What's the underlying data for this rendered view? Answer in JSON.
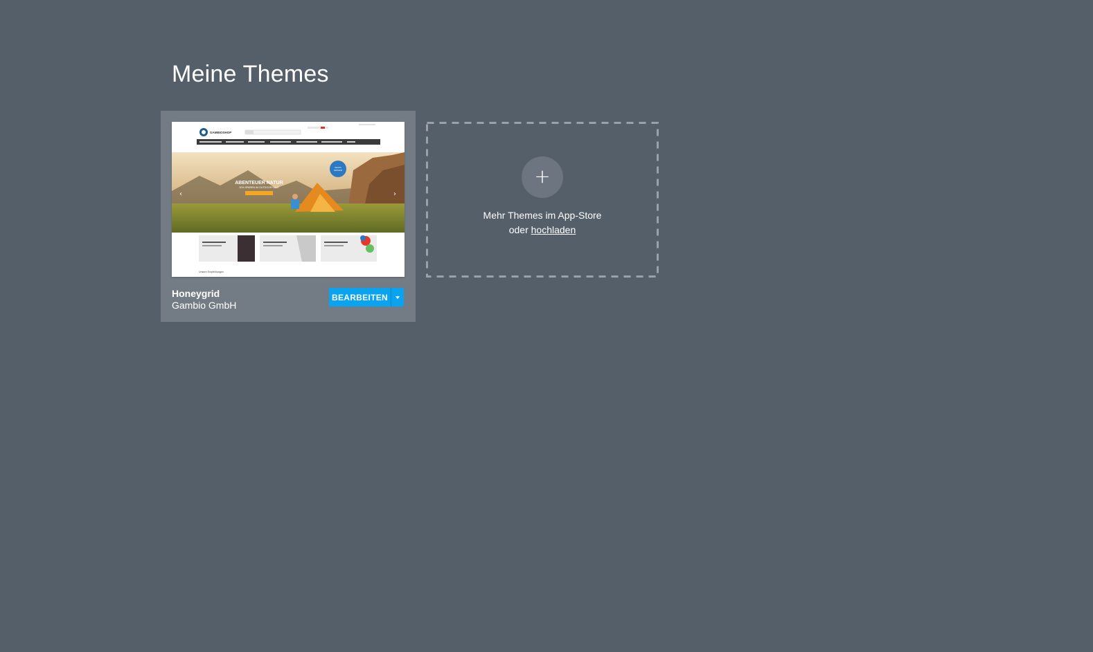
{
  "page": {
    "title": "Meine Themes"
  },
  "theme_card": {
    "name": "Honeygrid",
    "author": "Gambio GmbH",
    "edit_label": "BEARBEITEN",
    "preview": {
      "logo_text": "GAMBIOSHOP",
      "hero_title": "ABENTEUER NATUR",
      "hero_subtitle": "30% SPAREN IM OUTDOOR SALE",
      "section_label": "Unsere Empfehlungen"
    }
  },
  "add_theme": {
    "line1": "Mehr Themes im App-Store",
    "line2_prefix": "oder ",
    "upload_link": "hochladen",
    "plus_symbol": "+"
  },
  "colors": {
    "background": "#555f69",
    "card": "#737c85",
    "accent": "#0aa3f0"
  },
  "icons": {
    "add": "plus-icon",
    "dropdown": "caret-down-icon"
  }
}
